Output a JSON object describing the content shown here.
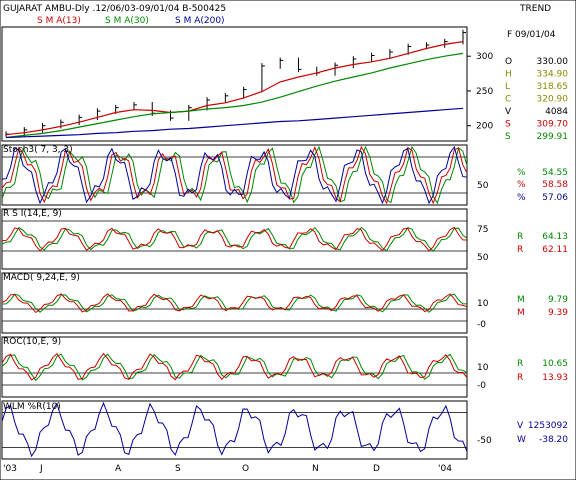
{
  "header": {
    "title": "GUJARAT AMBU-Dly .12/06/03-09/01/04  B-500425",
    "trend": "TREND",
    "sma13": "S M A(13)",
    "sma30": "S M A(30)",
    "sma200": "S M A(200)"
  },
  "ohlc": {
    "date": "F 09/01/04",
    "items": [
      {
        "label": "O",
        "value": "330.00",
        "color": "#000000"
      },
      {
        "label": "H",
        "value": "334.90",
        "color": "#8a8a00"
      },
      {
        "label": "L",
        "value": "318.65",
        "color": "#8a8a00"
      },
      {
        "label": "C",
        "value": "320.90",
        "color": "#8a8a00"
      },
      {
        "label": "V",
        "value": "4084",
        "color": "#000000"
      },
      {
        "label": "S",
        "value": "309.70",
        "color": "#cc0000"
      },
      {
        "label": "S",
        "value": "299.91",
        "color": "#008800"
      }
    ]
  },
  "panels": {
    "stoch": {
      "title": "Stoch3( 7, 3, 3)",
      "readouts": [
        {
          "label": "%",
          "value": "54.55",
          "color": "#008800"
        },
        {
          "label": "%",
          "value": "58.58",
          "color": "#cc0000"
        },
        {
          "label": "%",
          "value": "57.06",
          "color": "#000099"
        }
      ]
    },
    "rsi": {
      "title": "R S I(14,E, 9)",
      "readouts": [
        {
          "label": "R",
          "value": "64.13",
          "color": "#008800"
        },
        {
          "label": "R",
          "value": "62.11",
          "color": "#cc0000"
        }
      ]
    },
    "macd": {
      "title": "MACD( 9,24,E, 9)",
      "readouts": [
        {
          "label": "M",
          "value": "9.79",
          "color": "#008800"
        },
        {
          "label": "M",
          "value": "9.39",
          "color": "#cc0000"
        }
      ]
    },
    "roc": {
      "title": "ROC(10,E, 9)",
      "readouts": [
        {
          "label": "R",
          "value": "10.65",
          "color": "#008800"
        },
        {
          "label": "R",
          "value": "13.93",
          "color": "#cc0000"
        }
      ]
    },
    "wlm": {
      "title": "WLM %R(10)",
      "readouts": [
        {
          "label": "V",
          "value": "1253092",
          "color": "#000099"
        },
        {
          "label": "W",
          "value": "-38.20",
          "color": "#000099"
        }
      ]
    }
  },
  "chart_data": {
    "type": "line",
    "months": [
      "'03",
      "J",
      "A",
      "S",
      "O",
      "N",
      "D",
      "'04"
    ],
    "price_panel": {
      "yticks": [
        200,
        250,
        300
      ],
      "ylim": [
        178,
        342
      ],
      "series": [
        {
          "name": "S M A(13)",
          "color": "#cc0000",
          "values": [
            187,
            190,
            194,
            199,
            205,
            212,
            219,
            223,
            222,
            219,
            221,
            229,
            233,
            240,
            249,
            263,
            270,
            276,
            283,
            288,
            292,
            297,
            304,
            311,
            317,
            321
          ]
        },
        {
          "name": "S M A(30)",
          "color": "#008800",
          "values": [
            183,
            186,
            189,
            193,
            198,
            203,
            208,
            213,
            217,
            219,
            221,
            224,
            226,
            229,
            234,
            241,
            249,
            257,
            264,
            270,
            276,
            283,
            289,
            295,
            300,
            304
          ]
        },
        {
          "name": "S M A(200)",
          "color": "#000099",
          "values": [
            183,
            184,
            185,
            186,
            187,
            189,
            190,
            192,
            193,
            195,
            196,
            198,
            200,
            202,
            204,
            206,
            207,
            209,
            211,
            213,
            215,
            217,
            219,
            221,
            223,
            225
          ]
        }
      ],
      "close": [
        188,
        194,
        200,
        205,
        212,
        221,
        226,
        230,
        218,
        211,
        226,
        237,
        243,
        252,
        286,
        294,
        281,
        276,
        287,
        296,
        301,
        306,
        314,
        316,
        321,
        334
      ]
    },
    "stoch_levels": [
      20,
      50,
      80
    ],
    "rsi_levels": [
      50,
      75
    ],
    "macd_levels": [
      0,
      10
    ],
    "roc_levels": [
      0,
      10
    ],
    "wlm_levels": [
      -20,
      -50,
      -80
    ]
  }
}
